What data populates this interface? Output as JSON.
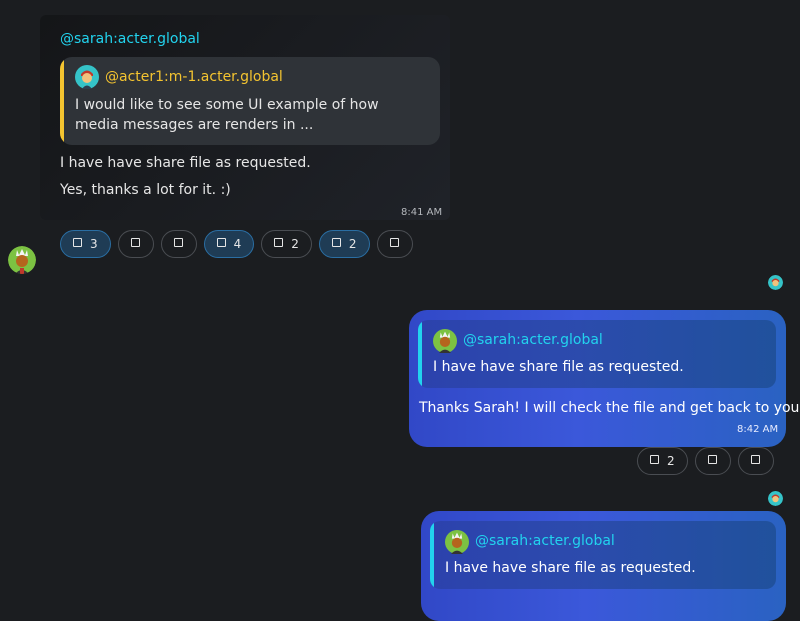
{
  "message1": {
    "sender": "@sarah:acter.global",
    "quote_user": "@acter1:m-1.acter.global",
    "quote_text": "I would like to see some UI example of how media messages are renders in ...",
    "line1": "I have have share file as requested.",
    "line2": "Yes, thanks a lot for it. :)",
    "time": "8:41 AM",
    "reactions": [
      {
        "count": "3"
      },
      {
        "count": ""
      },
      {
        "count": ""
      },
      {
        "count": "4"
      },
      {
        "count": "2"
      },
      {
        "count": "2"
      },
      {
        "count": ""
      }
    ]
  },
  "message2": {
    "quote_user": "@sarah:acter.global",
    "quote_text": "I have have share file as requested.",
    "text": "Thanks Sarah! I will check the file and get back to you.",
    "time": "8:42 AM",
    "reactions": [
      {
        "count": "2"
      },
      {
        "count": ""
      },
      {
        "count": ""
      }
    ]
  },
  "message3": {
    "quote_user": "@sarah:acter.global",
    "quote_text": "I have have share file as requested."
  },
  "colors": {
    "background": "#1b1d20",
    "mention_cyan": "#22d3ee",
    "mention_yellow": "#f4c430",
    "own_bubble": "#3b58da",
    "reaction_selected": "#1f3c55"
  }
}
